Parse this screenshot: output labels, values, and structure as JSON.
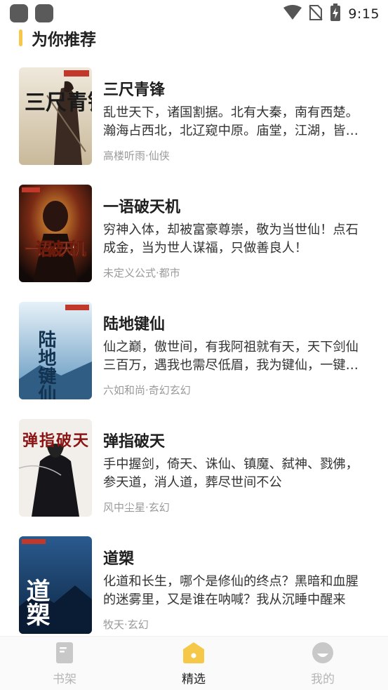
{
  "status_bar": {
    "time": "9:15"
  },
  "section": {
    "title": "为你推荐",
    "accent_color": "#f6c84a"
  },
  "books": [
    {
      "title": "三尺青锋",
      "description": "乱世天下，诸国割据。北有大秦，南有西楚。瀚海占西北，北辽窥中原。庙堂，江湖，皆风云变幻",
      "meta": "高楼听雨·仙侠",
      "cover_text": "三尺青锋",
      "cover_author": "高楼听雨"
    },
    {
      "title": "一语破天机",
      "description": "穷神入体，却被富豪尊崇，敬为当世仙！点石成金，当为世人谋福，只做善良人！",
      "meta": "未定义公式·都市",
      "cover_text": "一语破天机",
      "cover_author": "未定义公式"
    },
    {
      "title": "陆地键仙",
      "description": "仙之巅，傲世间，有我阿祖就有天，天下剑仙三百万，遇我也需尽低眉，我为键仙，一键成仙",
      "meta": "六如和尚·奇幻玄幻",
      "cover_text": "陆地键仙",
      "cover_author": "六如和尚"
    },
    {
      "title": "弹指破天",
      "description": "手中握剑，倚天、诛仙、镇魔、弑神、戮佛，参天道，消人道，葬尽世间不公",
      "meta": "风中尘星·玄幻",
      "cover_text": "弹指破天",
      "cover_author": "风中尘星"
    },
    {
      "title": "道槊",
      "description": "化道和长生，哪个是修仙的终点？黑暗和血腥的迷雾里，又是谁在呐喊？我从沉睡中醒来",
      "meta": "牧天·玄幻",
      "cover_text": "道槊",
      "cover_author": "牧天"
    }
  ],
  "nav": {
    "items": [
      {
        "label": "书架",
        "icon": "book-icon"
      },
      {
        "label": "精选",
        "icon": "house-icon",
        "active": true
      },
      {
        "label": "我的",
        "icon": "profile-icon"
      }
    ],
    "active_color": "#f6c84a",
    "inactive_color": "#c8c8c8"
  }
}
